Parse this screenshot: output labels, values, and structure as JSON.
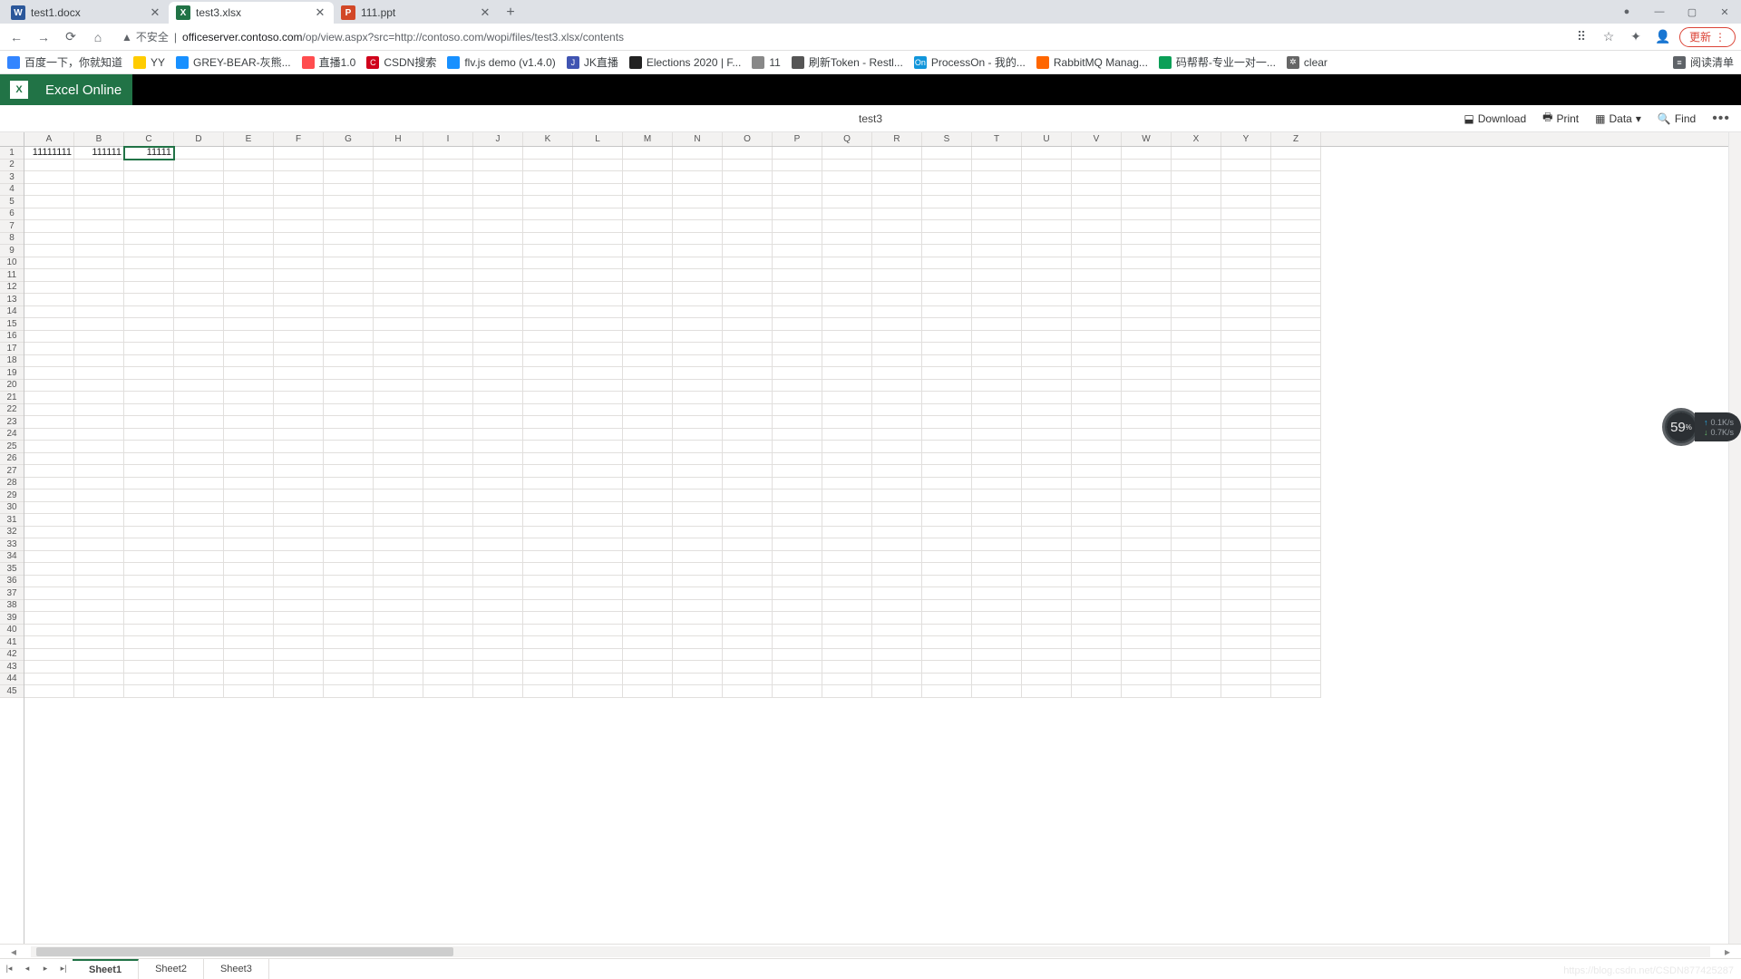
{
  "browser": {
    "tabs": [
      {
        "title": "test1.docx",
        "icon_bg": "#2b579a",
        "icon_text": "W",
        "active": false
      },
      {
        "title": "test3.xlsx",
        "icon_bg": "#217346",
        "icon_text": "X",
        "active": true
      },
      {
        "title": "111.ppt",
        "icon_bg": "#d24726",
        "icon_text": "P",
        "active": false
      }
    ],
    "window_controls": {
      "status_dot": "●",
      "min": "—",
      "max": "▢",
      "close": "✕"
    },
    "nav": {
      "back": "←",
      "forward": "→",
      "reload": "⟳",
      "home": "⌂"
    },
    "security_label": "不安全",
    "url_host": "officeserver.contoso.com",
    "url_rest": "/op/view.aspx?src=http://contoso.com/wopi/files/test3.xlsx/contents",
    "toolbar_icons": {
      "translate": "⠿",
      "star": "☆",
      "ext": "✦",
      "profile": "👤"
    },
    "update_label": "更新",
    "bookmarks": [
      {
        "label": "百度一下，你就知道",
        "bg": "#3385ff",
        "t": ""
      },
      {
        "label": "YY",
        "bg": "#ffcc00",
        "t": ""
      },
      {
        "label": "GREY-BEAR-灰熊...",
        "bg": "#1890ff",
        "t": ""
      },
      {
        "label": "直播1.0",
        "bg": "#ff4d4f",
        "t": ""
      },
      {
        "label": "CSDN搜索",
        "bg": "#d0021b",
        "t": "C"
      },
      {
        "label": "flv.js demo (v1.4.0)",
        "bg": "#1890ff",
        "t": ""
      },
      {
        "label": "JK直播",
        "bg": "#4054b2",
        "t": "J"
      },
      {
        "label": "Elections 2020 | F...",
        "bg": "#222",
        "t": ""
      },
      {
        "label": "11",
        "bg": "#888",
        "t": ""
      },
      {
        "label": "刷新Token - Restl...",
        "bg": "#555",
        "t": ""
      },
      {
        "label": "ProcessOn - 我的...",
        "bg": "#1296db",
        "t": "On"
      },
      {
        "label": "RabbitMQ Manag...",
        "bg": "#ff6600",
        "t": ""
      },
      {
        "label": "码帮帮-专业一对一...",
        "bg": "#0b9f57",
        "t": ""
      },
      {
        "label": "clear",
        "bg": "#666",
        "t": "✲"
      }
    ],
    "reading_list_label": "阅读清单"
  },
  "app": {
    "logo_text": "X",
    "title": "Excel Online",
    "file_name": "test3",
    "commands": {
      "download": "Download",
      "print": "Print",
      "data": "Data",
      "find": "Find"
    }
  },
  "sheet": {
    "columns": [
      "A",
      "B",
      "C",
      "D",
      "E",
      "F",
      "G",
      "H",
      "I",
      "J",
      "K",
      "L",
      "M",
      "N",
      "O",
      "P",
      "Q",
      "R",
      "S",
      "T",
      "U",
      "V",
      "W",
      "X",
      "Y",
      "Z"
    ],
    "row_count": 45,
    "selected_cell": "C1",
    "cells": {
      "A1": "11111111",
      "B1": "111111",
      "C1": "11111"
    },
    "tabs": [
      "Sheet1",
      "Sheet2",
      "Sheet3"
    ],
    "active_tab": "Sheet1"
  },
  "perf": {
    "percent": "59",
    "up": "0.1K/s",
    "down": "0.7K/s"
  },
  "watermark": "https://blog.csdn.net/CSDN877425287"
}
